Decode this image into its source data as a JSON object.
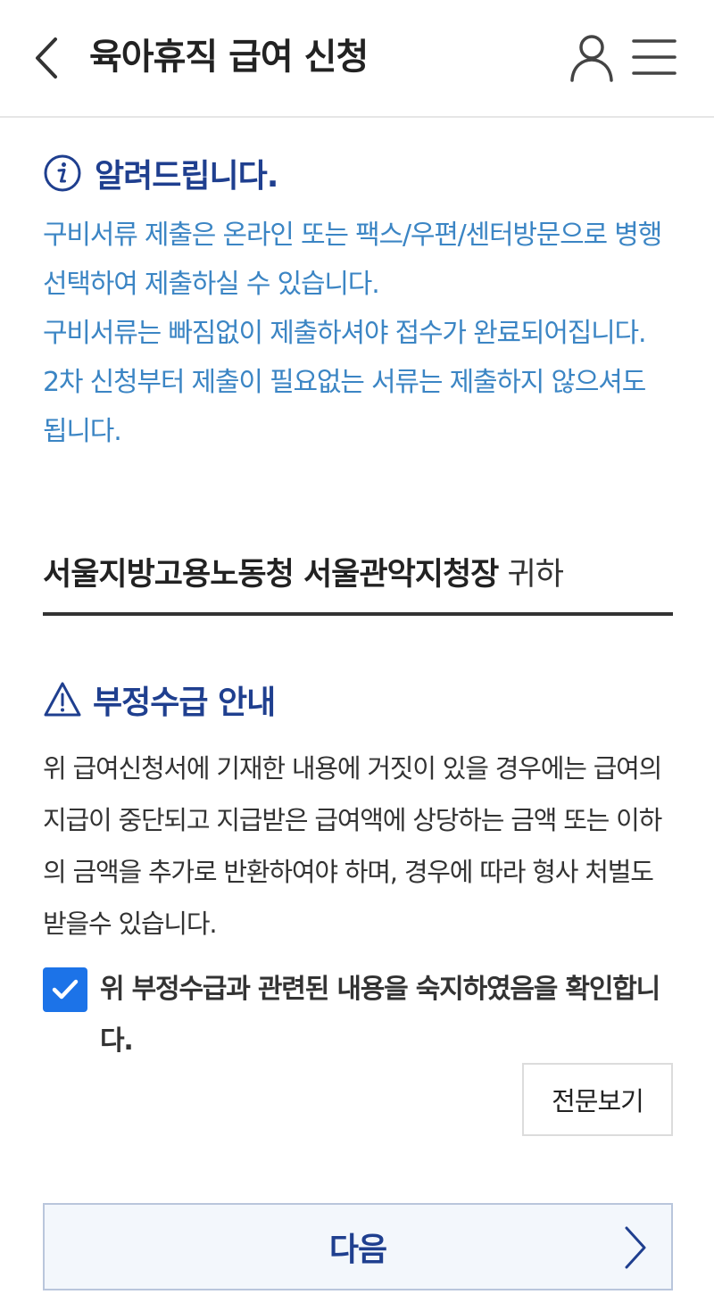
{
  "header": {
    "title": "육아휴직 급여 신청",
    "back_icon": "chevron-left-icon",
    "user_icon": "user-icon",
    "menu_icon": "hamburger-menu-icon"
  },
  "notice": {
    "icon": "info-icon",
    "title": "알려드립니다.",
    "paragraphs": [
      "구비서류 제출은 온라인 또는 팩스/우편/센터방문으로 병행 선택하여 제출하실 수 있습니다.",
      "구비서류는 빠짐없이 제출하셔야 접수가 완료되어집니다.",
      "2차 신청부터 제출이 필요없는 서류는 제출하지 않으셔도 됩니다."
    ],
    "color": "#3b85c4"
  },
  "addressee": {
    "org": "서울지방고용노동청 서울관악지청장",
    "suffix": "귀하"
  },
  "fraud_notice": {
    "icon": "warning-triangle-icon",
    "title": "부정수급 안내",
    "body": "위 급여신청서에 기재한 내용에 거짓이 있을 경우에는 급여의 지급이 중단되고 지급받은 급여액에 상당하는 금액 또는 이하의 금액을 추가로 반환하여야 하며, 경우에 따라 형사 처벌도 받을수 있습니다."
  },
  "agreement": {
    "checked": true,
    "label": "위 부정수급과 관련된 내용을 숙지하였음을 확인합니다.",
    "check_color": "#1c73e8"
  },
  "buttons": {
    "full_text": "전문보기",
    "next": "다음",
    "next_icon": "chevron-right-icon"
  },
  "colors": {
    "accent": "#1f3f8f",
    "checkbox": "#1c73e8"
  }
}
